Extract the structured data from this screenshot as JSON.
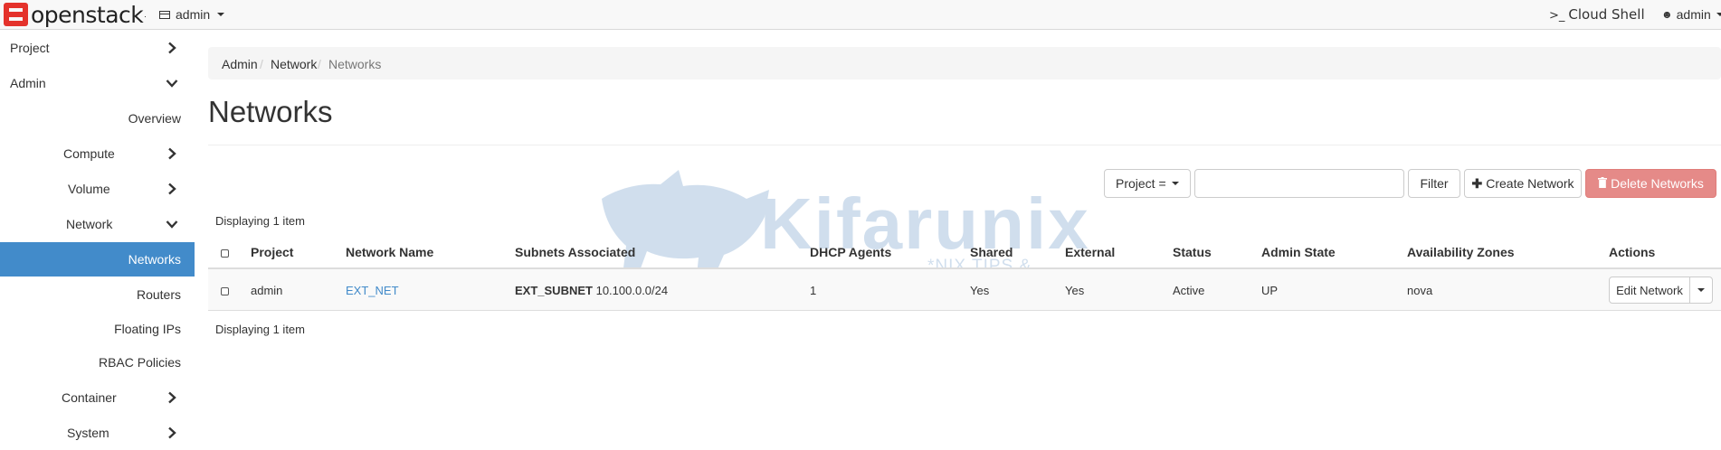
{
  "navbar": {
    "brand": "openstack",
    "brand_tm": ".",
    "project_switcher": "admin",
    "cloud_shell_prompt": ">_",
    "cloud_shell": "Cloud Shell",
    "user": "admin"
  },
  "sidebar": {
    "items": [
      {
        "label": "Project"
      },
      {
        "label": "Admin"
      },
      {
        "label": "Overview"
      },
      {
        "label": "Compute"
      },
      {
        "label": "Volume"
      },
      {
        "label": "Network"
      },
      {
        "label": "Networks"
      },
      {
        "label": "Routers"
      },
      {
        "label": "Floating IPs"
      },
      {
        "label": "RBAC Policies"
      },
      {
        "label": "Container"
      },
      {
        "label": "System"
      }
    ]
  },
  "breadcrumb": {
    "items": [
      "Admin",
      "Network",
      "Networks"
    ],
    "separator": "/"
  },
  "page": {
    "title": "Networks"
  },
  "toolbar": {
    "filter_field": "Project =",
    "filter_value": "",
    "filter_button": "Filter",
    "create_button": "Create Network",
    "delete_button": "Delete Networks"
  },
  "table": {
    "displaying_top": "Displaying 1 item",
    "displaying_bottom": "Displaying 1 item",
    "columns": [
      "Project",
      "Network Name",
      "Subnets Associated",
      "DHCP Agents",
      "Shared",
      "External",
      "Status",
      "Admin State",
      "Availability Zones",
      "Actions"
    ],
    "rows": [
      {
        "project": "admin",
        "network_name": "EXT_NET",
        "subnet_name": "EXT_SUBNET",
        "subnet_cidr": "10.100.0.0/24",
        "dhcp_agents": "1",
        "shared": "Yes",
        "external": "Yes",
        "status": "Active",
        "admin_state": "UP",
        "availability_zones": "nova",
        "action": "Edit Network"
      }
    ]
  },
  "watermark": {
    "text": "Kifarunix",
    "subtitle": "*NIX TIPS & TUTORIALS"
  },
  "colors": {
    "brand_red": "#e4322b",
    "active_blue": "#428bca",
    "danger": "#e58a88"
  },
  "icons": {
    "brand": "openstack-logo-icon",
    "project": "project-icon",
    "user": "user-icon",
    "chevron_right": "chevron-right-icon",
    "chevron_down": "chevron-down-icon",
    "plus": "plus-icon",
    "trash": "trash-icon"
  }
}
